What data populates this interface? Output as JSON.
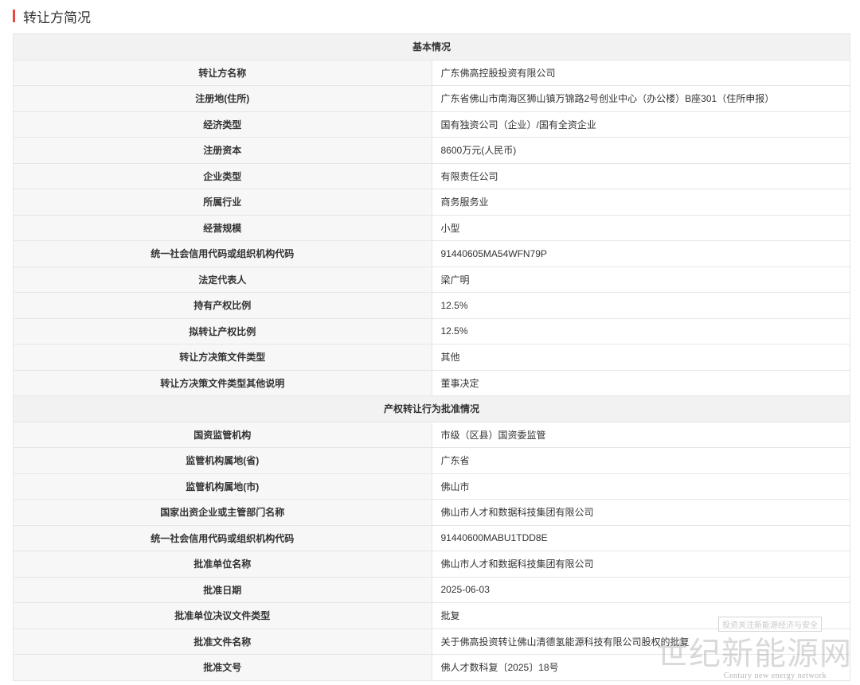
{
  "header": {
    "title": "转让方简况"
  },
  "basic": {
    "heading": "基本情况",
    "rows": [
      {
        "label": "转让方名称",
        "value": "广东佛高控股投资有限公司"
      },
      {
        "label": "注册地(住所)",
        "value": "广东省佛山市南海区狮山镇万锦路2号创业中心（办公楼）B座301（住所申报）"
      },
      {
        "label": "经济类型",
        "value": "国有独资公司（企业）/国有全资企业"
      },
      {
        "label": "注册资本",
        "value": "8600万元(人民币)"
      },
      {
        "label": "企业类型",
        "value": "有限责任公司"
      },
      {
        "label": "所属行业",
        "value": "商务服务业"
      },
      {
        "label": "经营规模",
        "value": "小型"
      },
      {
        "label": "统一社会信用代码或组织机构代码",
        "value": "91440605MA54WFN79P"
      },
      {
        "label": "法定代表人",
        "value": "梁广明"
      },
      {
        "label": "持有产权比例",
        "value": "12.5%"
      },
      {
        "label": "拟转让产权比例",
        "value": "12.5%"
      },
      {
        "label": "转让方决策文件类型",
        "value": "其他"
      },
      {
        "label": "转让方决策文件类型其他说明",
        "value": "董事决定"
      }
    ]
  },
  "approval": {
    "heading": "产权转让行为批准情况",
    "rows": [
      {
        "label": "国资监管机构",
        "value": "市级（区县）国资委监管"
      },
      {
        "label": "监管机构属地(省)",
        "value": "广东省"
      },
      {
        "label": "监管机构属地(市)",
        "value": "佛山市"
      },
      {
        "label": "国家出资企业或主管部门名称",
        "value": "佛山市人才和数据科技集团有限公司"
      },
      {
        "label": "统一社会信用代码或组织机构代码",
        "value": "91440600MABU1TDD8E"
      },
      {
        "label": "批准单位名称",
        "value": "佛山市人才和数据科技集团有限公司"
      },
      {
        "label": "批准日期",
        "value": "2025-06-03"
      },
      {
        "label": "批准单位决议文件类型",
        "value": "批复"
      },
      {
        "label": "批准文件名称",
        "value": "关于佛高投资转让佛山清德氢能源科技有限公司股权的批复"
      },
      {
        "label": "批准文号",
        "value": "佛人才数科复〔2025〕18号"
      }
    ]
  },
  "watermark": {
    "slogan": "投资关注新能源经济与安全",
    "main": "世纪新能源网",
    "sub": "Century new energy network"
  }
}
